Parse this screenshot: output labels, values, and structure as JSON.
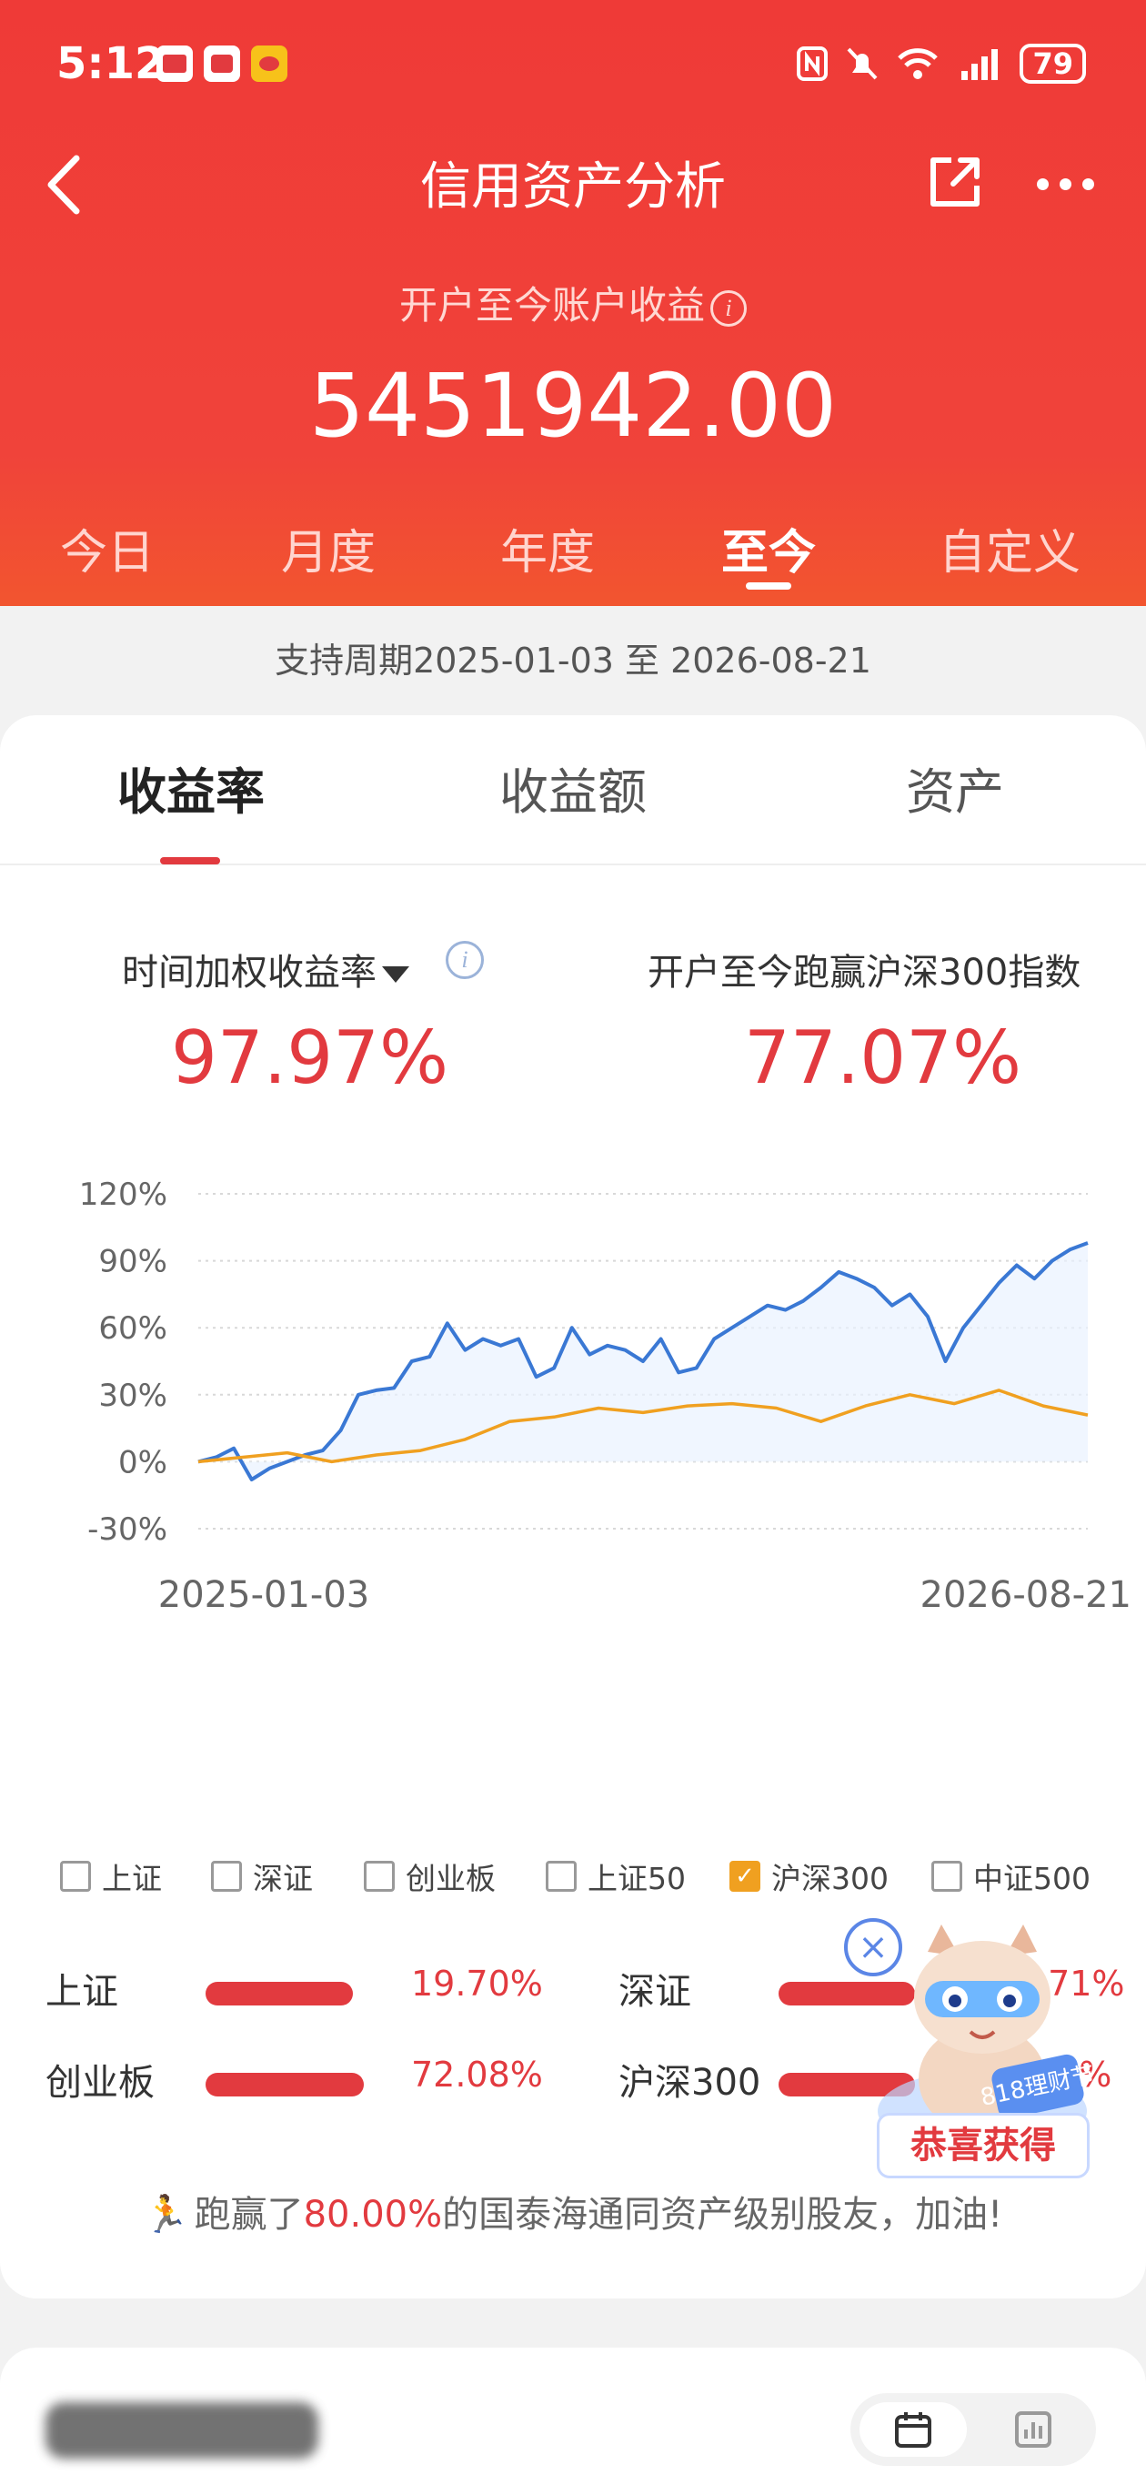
{
  "status_bar": {
    "time": "5:12",
    "battery": "79"
  },
  "header": {
    "title": "信用资产分析",
    "subtitle": "开户至今账户收益",
    "info_glyph": "i",
    "amount": "5451942.00"
  },
  "period_tabs": [
    "今日",
    "月度",
    "年度",
    "至今",
    "自定义"
  ],
  "period_text": "支持周期2025-01-03 至 2026-08-21",
  "sub_tabs": [
    "收益率",
    "收益额",
    "资产"
  ],
  "metrics": {
    "left_label": "时间加权收益率",
    "left_value": "97.97%",
    "right_label": "开户至今跑赢沪深300指数",
    "right_value": "77.07%"
  },
  "chart_data": {
    "type": "line",
    "y_ticks": [
      "120%",
      "90%",
      "60%",
      "30%",
      "0%",
      "-30%"
    ],
    "ylim": [
      -30,
      120
    ],
    "x_start_label": "2025-01-03",
    "x_end_label": "2026-08-21",
    "grid": "dashed horizontal",
    "colors": {
      "account": "#3a78d4",
      "index": "#f0a020"
    },
    "series": [
      {
        "key": "account",
        "t": [
          0,
          0.02,
          0.04,
          0.06,
          0.08,
          0.1,
          0.12,
          0.14,
          0.16,
          0.18,
          0.2,
          0.22,
          0.24,
          0.26,
          0.28,
          0.3,
          0.32,
          0.34,
          0.36,
          0.38,
          0.4,
          0.42,
          0.44,
          0.46,
          0.48,
          0.5,
          0.52,
          0.54,
          0.56,
          0.58,
          0.6,
          0.62,
          0.64,
          0.66,
          0.68,
          0.7,
          0.72,
          0.74,
          0.76,
          0.78,
          0.8,
          0.82,
          0.84,
          0.86,
          0.88,
          0.9,
          0.92,
          0.94,
          0.96,
          0.98,
          1.0
        ],
        "values": [
          0,
          2,
          6,
          -8,
          -3,
          0,
          3,
          5,
          14,
          30,
          32,
          33,
          45,
          47,
          62,
          50,
          55,
          52,
          55,
          38,
          42,
          60,
          48,
          52,
          50,
          45,
          55,
          40,
          42,
          55,
          60,
          65,
          70,
          68,
          72,
          78,
          85,
          82,
          78,
          70,
          75,
          65,
          45,
          60,
          70,
          80,
          88,
          82,
          90,
          95,
          97.97
        ]
      },
      {
        "key": "index",
        "t": [
          0,
          0.05,
          0.1,
          0.15,
          0.2,
          0.25,
          0.3,
          0.35,
          0.4,
          0.45,
          0.5,
          0.55,
          0.6,
          0.65,
          0.7,
          0.75,
          0.8,
          0.85,
          0.9,
          0.95,
          1.0
        ],
        "values": [
          0,
          2,
          4,
          0,
          3,
          5,
          10,
          18,
          20,
          24,
          22,
          25,
          26,
          24,
          18,
          25,
          30,
          26,
          32,
          25,
          20.9
        ]
      }
    ]
  },
  "legend": [
    {
      "label": "上证",
      "checked": false
    },
    {
      "label": "深证",
      "checked": false
    },
    {
      "label": "创业板",
      "checked": false
    },
    {
      "label": "上证50",
      "checked": false
    },
    {
      "label": "沪深300",
      "checked": true
    },
    {
      "label": "中证500",
      "checked": false
    }
  ],
  "comparisons": [
    {
      "label": "上证",
      "value": "19.70%",
      "bar": 0.5
    },
    {
      "label": "深证",
      "value": ".71%",
      "bar": 0.55
    },
    {
      "label": "创业板",
      "value": "72.08%",
      "bar": 0.52
    },
    {
      "label": "沪深300",
      "value": ".0%",
      "bar": 0.55
    }
  ],
  "beat": {
    "prefix": "跑赢了",
    "value": "80.00%",
    "suffix": "的国泰海通同资产级别股友，加油!"
  },
  "promo": {
    "close": "×",
    "badge": "恭喜获得",
    "mascot_text": "818理财节"
  }
}
